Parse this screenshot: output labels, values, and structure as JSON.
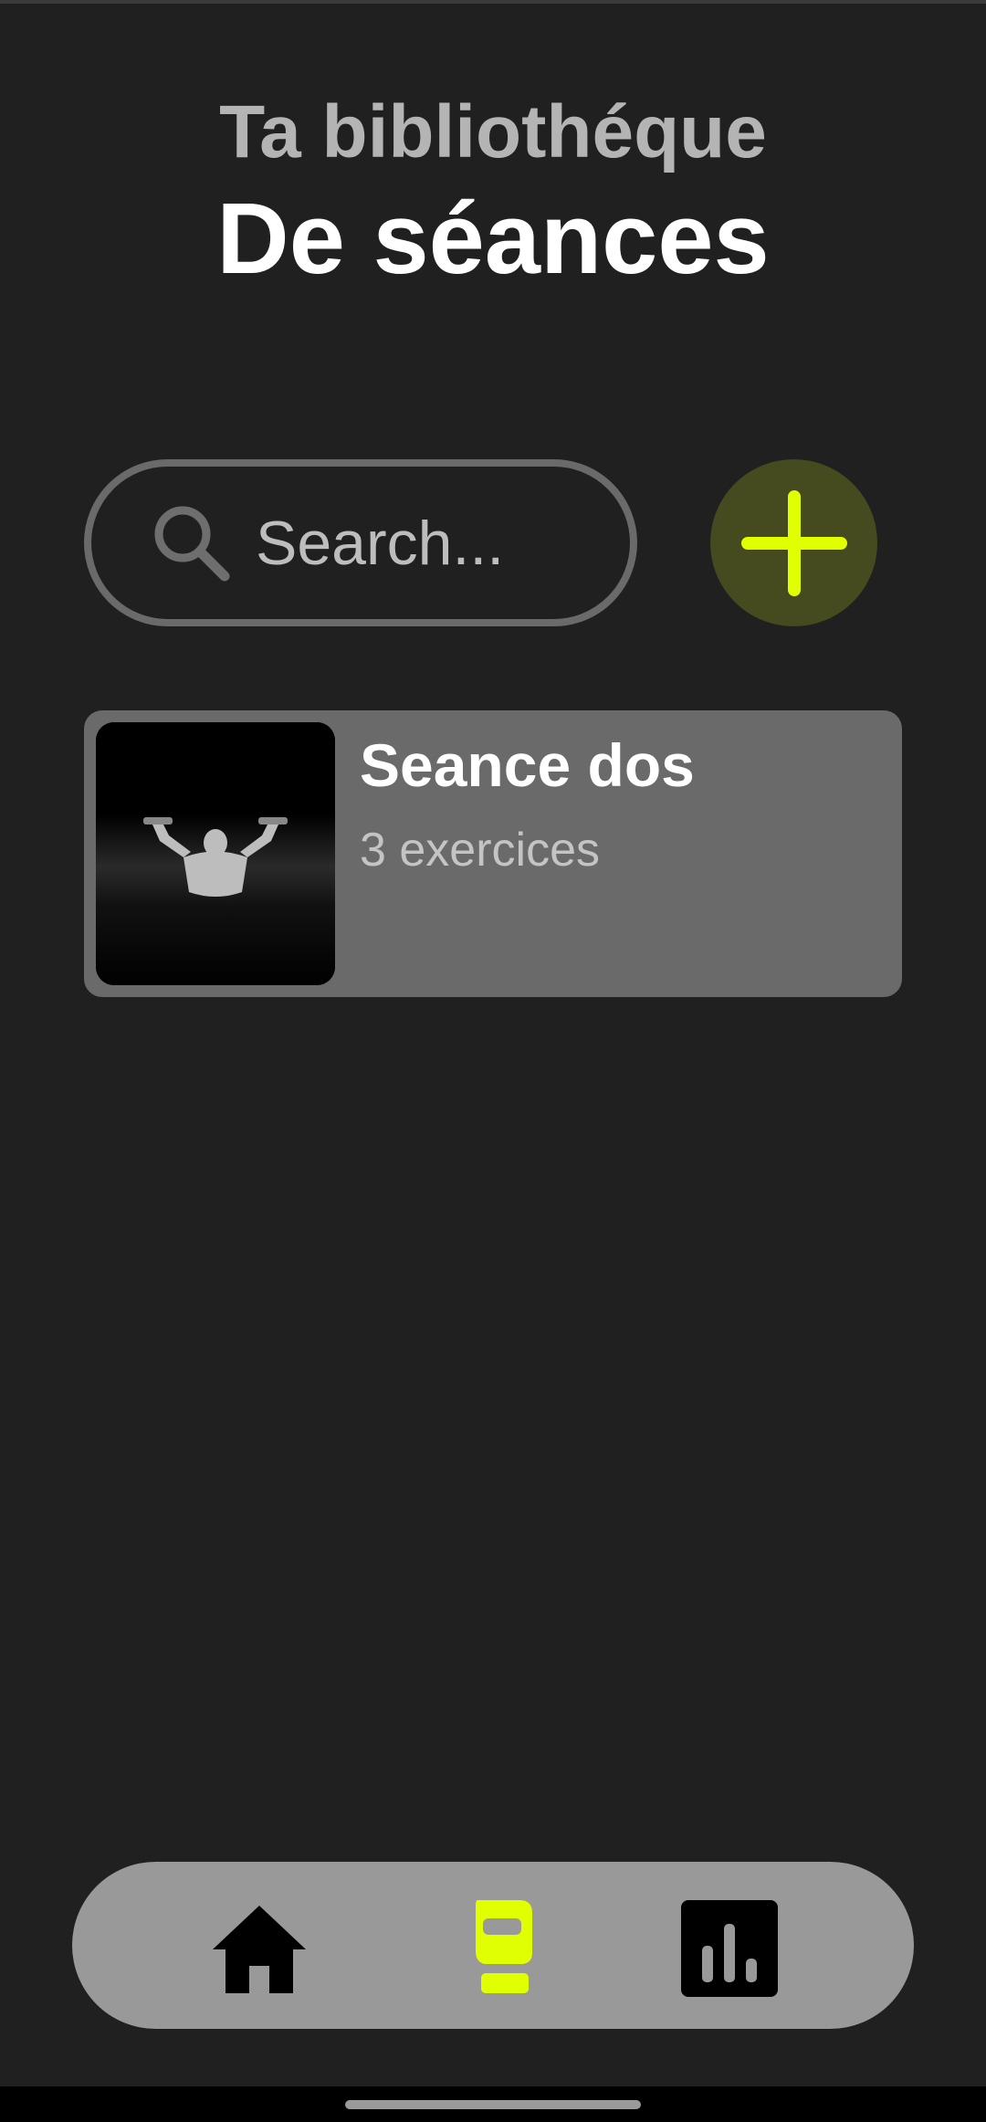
{
  "header": {
    "subtitle": "Ta bibliothéque",
    "title": "De séances"
  },
  "search": {
    "placeholder": "Search...",
    "icon": "search-icon"
  },
  "add_button": {
    "icon": "plus-icon",
    "color": "#e0ff00"
  },
  "sessions": [
    {
      "name": "Seance dos",
      "count": "3 exercices",
      "image": "back-workout-photo"
    }
  ],
  "nav": {
    "items": [
      {
        "id": "home",
        "icon": "home-icon",
        "active": false
      },
      {
        "id": "workouts",
        "icon": "boxing-glove-icon",
        "active": true
      },
      {
        "id": "stats",
        "icon": "bar-chart-icon",
        "active": false
      }
    ],
    "active_color": "#e0ff00"
  },
  "colors": {
    "background": "#202020",
    "accent": "#e0ff00",
    "card": "#6a6a6a"
  }
}
